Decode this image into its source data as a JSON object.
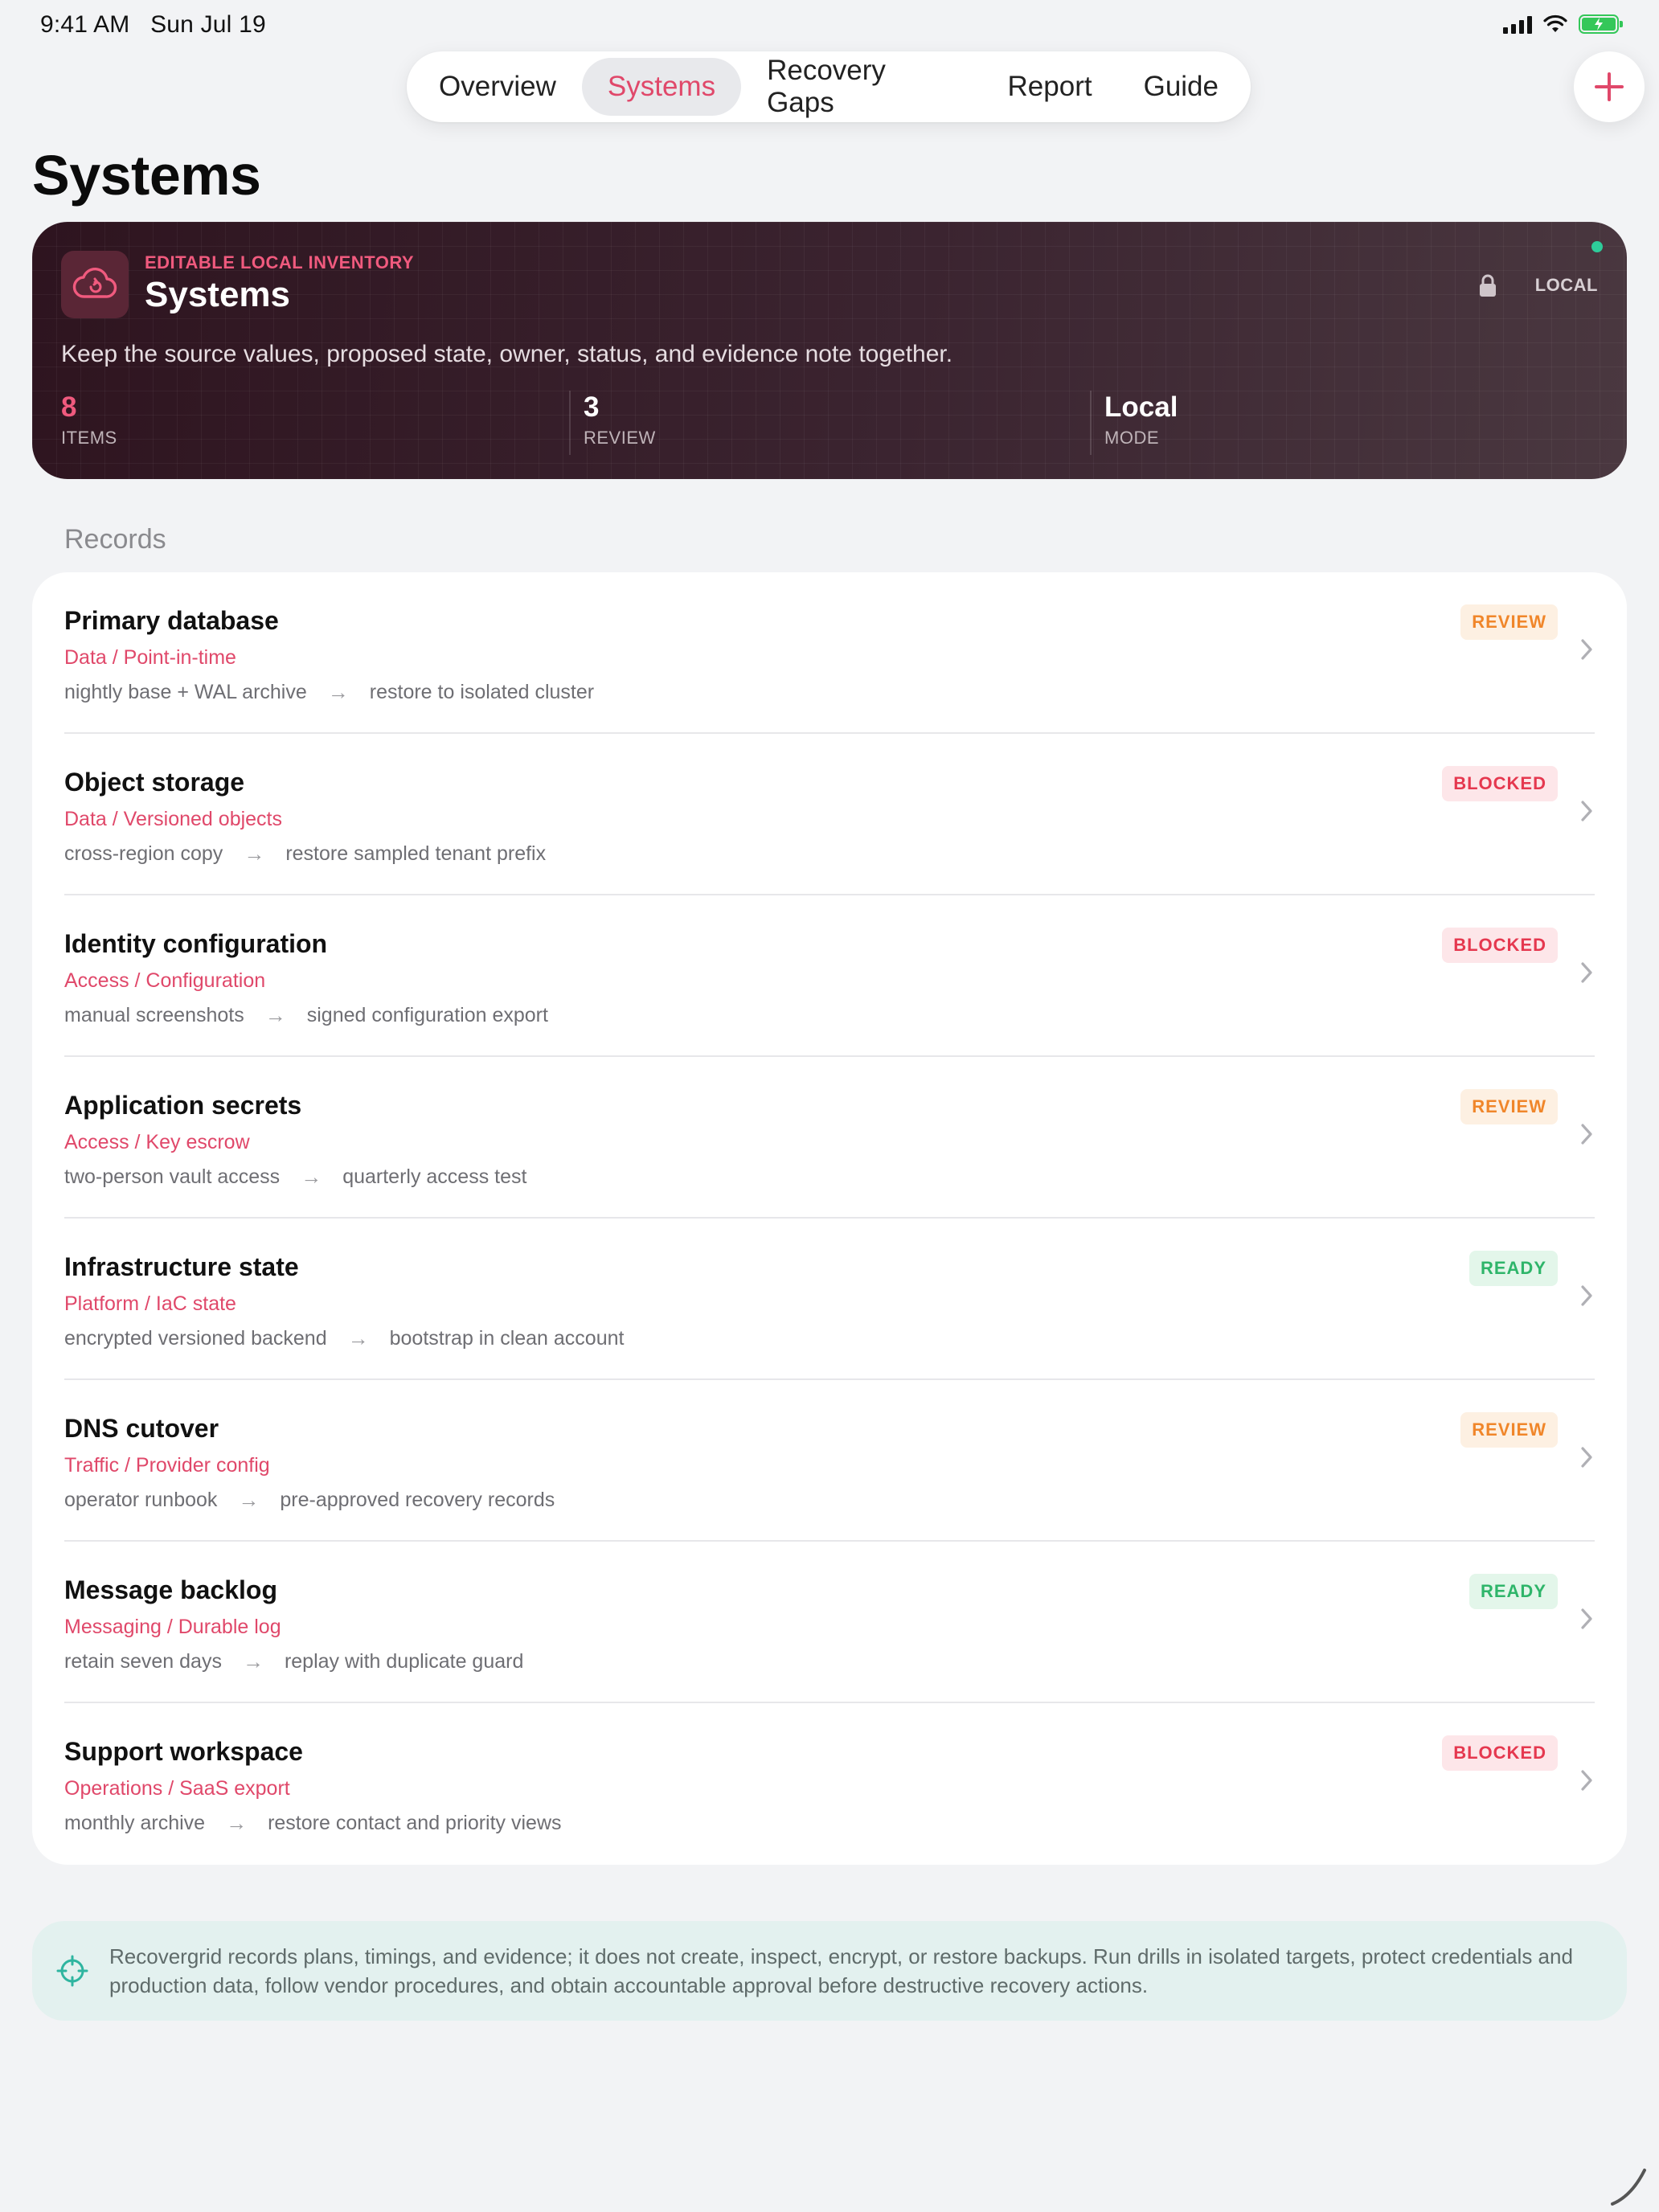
{
  "status_bar": {
    "time": "9:41 AM",
    "date": "Sun Jul 19"
  },
  "nav": {
    "tabs": [
      {
        "label": "Overview",
        "active": false
      },
      {
        "label": "Systems",
        "active": true
      },
      {
        "label": "Recovery Gaps",
        "active": false
      },
      {
        "label": "Report",
        "active": false
      },
      {
        "label": "Guide",
        "active": false
      }
    ],
    "add_icon": "plus-icon"
  },
  "page": {
    "title": "Systems"
  },
  "hero": {
    "icon": "cloud-restore-icon",
    "eyebrow": "EDITABLE LOCAL INVENTORY",
    "title": "Systems",
    "badge": "LOCAL",
    "description": "Keep the source values, proposed state, owner, status, and evidence note together.",
    "stats": [
      {
        "value": "8",
        "label": "ITEMS"
      },
      {
        "value": "3",
        "label": "REVIEW"
      },
      {
        "value": "Local",
        "label": "MODE"
      }
    ]
  },
  "records": {
    "section_label": "Records",
    "items": [
      {
        "title": "Primary database",
        "category": "Data / Point-in-time",
        "source": "nightly base + WAL archive",
        "target": "restore to isolated cluster",
        "status": "REVIEW"
      },
      {
        "title": "Object storage",
        "category": "Data / Versioned objects",
        "source": "cross-region copy",
        "target": "restore sampled tenant prefix",
        "status": "BLOCKED"
      },
      {
        "title": "Identity configuration",
        "category": "Access / Configuration",
        "source": "manual screenshots",
        "target": "signed configuration export",
        "status": "BLOCKED"
      },
      {
        "title": "Application secrets",
        "category": "Access / Key escrow",
        "source": "two-person vault access",
        "target": "quarterly access test",
        "status": "REVIEW"
      },
      {
        "title": "Infrastructure state",
        "category": "Platform / IaC state",
        "source": "encrypted versioned backend",
        "target": "bootstrap in clean account",
        "status": "READY"
      },
      {
        "title": "DNS cutover",
        "category": "Traffic / Provider config",
        "source": "operator runbook",
        "target": "pre-approved recovery records",
        "status": "REVIEW"
      },
      {
        "title": "Message backlog",
        "category": "Messaging / Durable log",
        "source": "retain seven days",
        "target": "replay with duplicate guard",
        "status": "READY"
      },
      {
        "title": "Support workspace",
        "category": "Operations / SaaS export",
        "source": "monthly archive",
        "target": "restore contact and priority views",
        "status": "BLOCKED"
      }
    ]
  },
  "status_colors": {
    "REVIEW": {
      "text": "#f0862a",
      "bg": "#fdf0e2"
    },
    "BLOCKED": {
      "text": "#e5384f",
      "bg": "#fde6e9"
    },
    "READY": {
      "text": "#2fb56a",
      "bg": "#e3f6ea"
    }
  },
  "note": {
    "icon": "crosshair-icon",
    "text": "Recovergrid records plans, timings, and evidence; it does not create, inspect, encrypt, or restore backups. Run drills in isolated targets, protect credentials and production data, follow vendor procedures, and obtain accountable approval before destructive recovery actions."
  },
  "colors": {
    "accent": "#e0486a",
    "hero_bg": "#2e141f",
    "page_bg": "#f2f3f5"
  }
}
